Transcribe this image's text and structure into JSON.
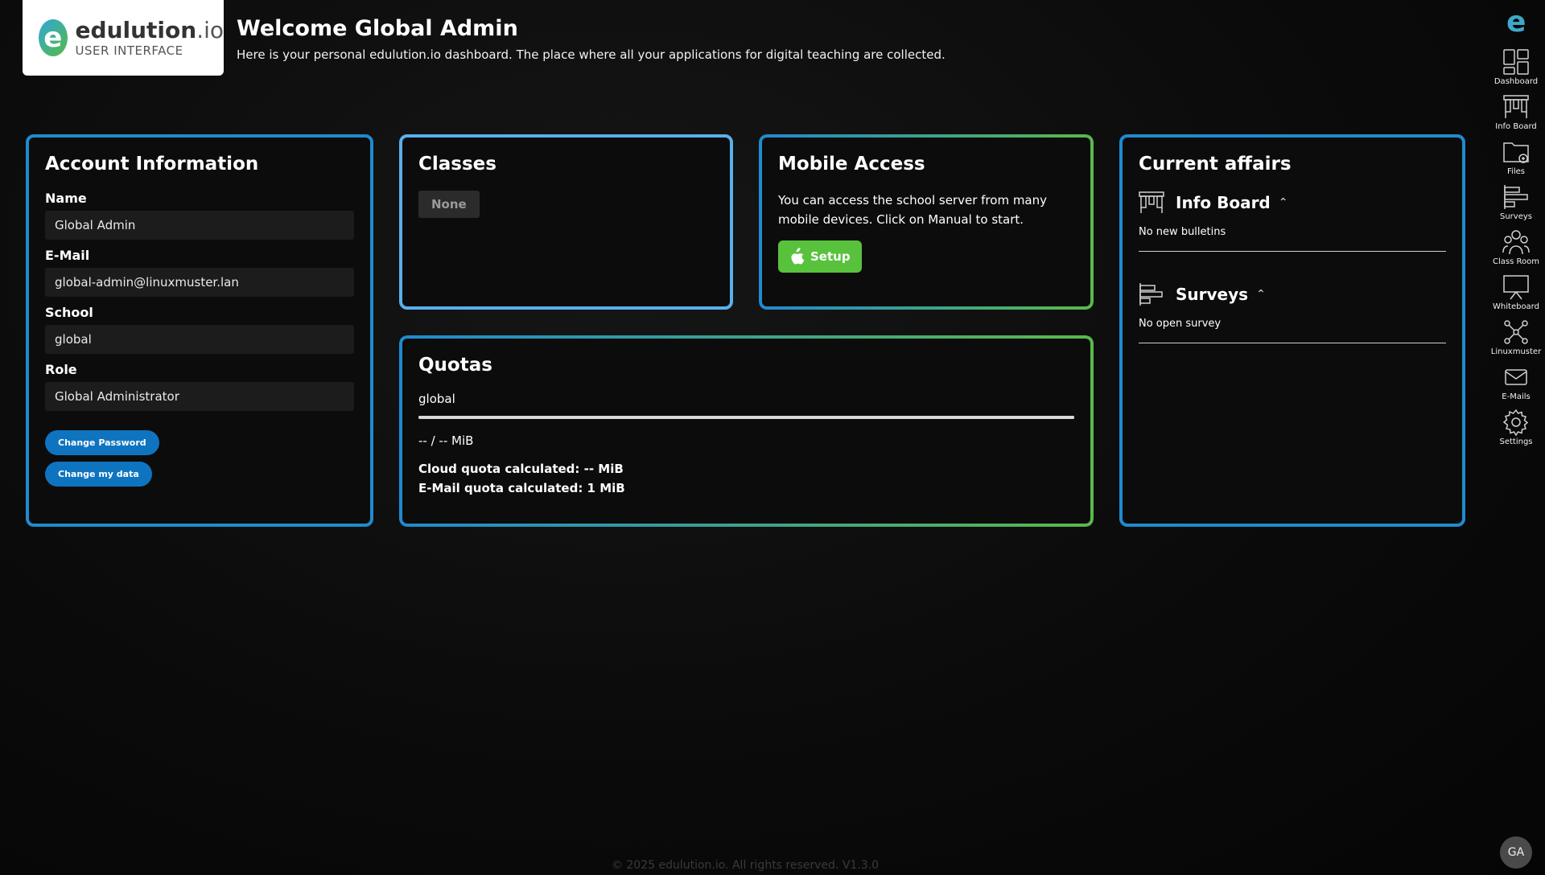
{
  "logo": {
    "title": "edulution",
    "suffix": ".io",
    "subtitle": "USER INTERFACE",
    "letter": "e"
  },
  "header": {
    "title": "Welcome Global Admin",
    "subtitle": "Here is your personal edulution.io dashboard. The place where all your applications for digital teaching are collected."
  },
  "account": {
    "title": "Account Information",
    "fields": [
      {
        "label": "Name",
        "value": "Global Admin"
      },
      {
        "label": "E-Mail",
        "value": "global-admin@linuxmuster.lan"
      },
      {
        "label": "School",
        "value": "global"
      },
      {
        "label": "Role",
        "value": "Global Administrator"
      }
    ],
    "change_password": "Change Password",
    "change_data": "Change my data"
  },
  "classes": {
    "title": "Classes",
    "empty": "None"
  },
  "mobile": {
    "title": "Mobile Access",
    "text": "You can access the school server from many mobile devices. Click on Manual to start.",
    "setup": "Setup"
  },
  "quotas": {
    "title": "Quotas",
    "name": "global",
    "usage_fraction": 1.0,
    "usage": "-- / -- MiB",
    "cloud": "Cloud quota calculated: -- MiB",
    "email": "E-Mail quota calculated: 1 MiB"
  },
  "affairs": {
    "title": "Current affairs",
    "infoboard": {
      "title": "Info Board",
      "text": "No new bulletins"
    },
    "surveys": {
      "title": "Surveys",
      "text": "No open survey"
    }
  },
  "sidebar": {
    "logo": "e",
    "items": [
      {
        "label": "Dashboard",
        "icon": "dashboard-icon"
      },
      {
        "label": "Info Board",
        "icon": "infoboard-icon"
      },
      {
        "label": "Files",
        "icon": "files-icon"
      },
      {
        "label": "Surveys",
        "icon": "surveys-icon"
      },
      {
        "label": "Class Room",
        "icon": "classroom-icon"
      },
      {
        "label": "Whiteboard",
        "icon": "whiteboard-icon"
      },
      {
        "label": "Linuxmuster",
        "icon": "linuxmuster-icon"
      },
      {
        "label": "E-Mails",
        "icon": "email-icon"
      },
      {
        "label": "Settings",
        "icon": "gear-icon"
      }
    ],
    "avatar": "GA"
  },
  "footer": "© 2025 edulution.io. All rights reserved. V1.3.0",
  "colors": {
    "blue": "#1f8bd0",
    "green": "#59ba4a",
    "light_blue": "#5ab0ea",
    "setup_green": "#58c23c"
  }
}
